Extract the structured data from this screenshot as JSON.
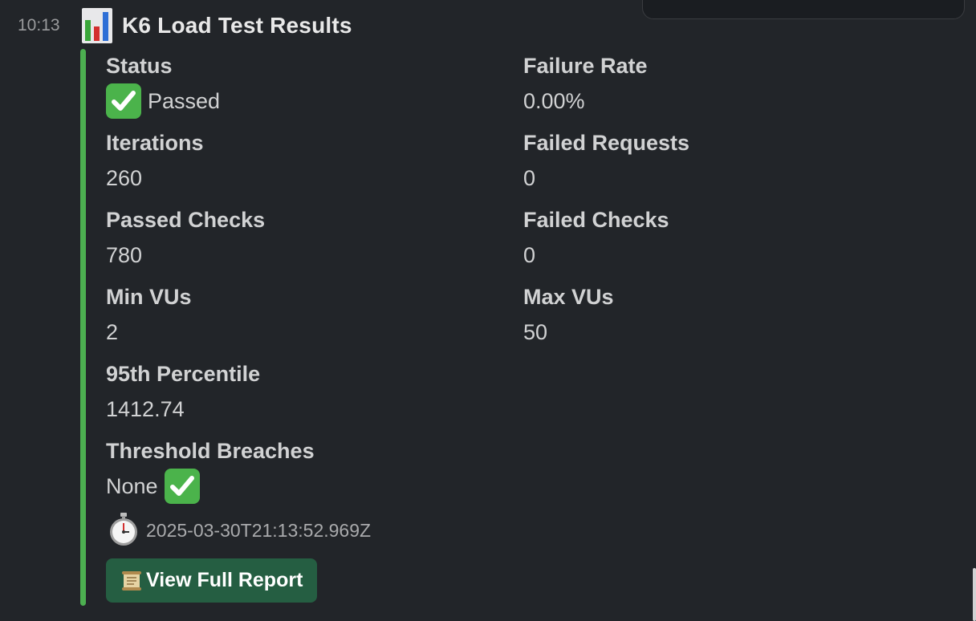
{
  "message": {
    "time": "10:13",
    "title": "K6 Load Test Results",
    "title_icon": "bar-chart-icon",
    "accent_color": "#4caf50"
  },
  "fields": {
    "status": {
      "label": "Status",
      "value": "Passed",
      "icon": "white-check-mark-icon"
    },
    "failure_rate": {
      "label": "Failure Rate",
      "value": "0.00%"
    },
    "iterations": {
      "label": "Iterations",
      "value": "260"
    },
    "failed_requests": {
      "label": "Failed Requests",
      "value": "0"
    },
    "passed_checks": {
      "label": "Passed Checks",
      "value": "780"
    },
    "failed_checks": {
      "label": "Failed Checks",
      "value": "0"
    },
    "min_vus": {
      "label": "Min VUs",
      "value": "2"
    },
    "max_vus": {
      "label": "Max VUs",
      "value": "50"
    },
    "p95": {
      "label": "95th Percentile",
      "value": "1412.74"
    },
    "threshold_breaches": {
      "label": "Threshold Breaches",
      "value": "None",
      "icon": "white-check-mark-icon"
    }
  },
  "footer": {
    "timestamp": "2025-03-30T21:13:52.969Z",
    "timestamp_icon": "stopwatch-icon"
  },
  "button": {
    "label": "View Full Report",
    "icon": "scroll-icon",
    "color": "#255e42"
  }
}
